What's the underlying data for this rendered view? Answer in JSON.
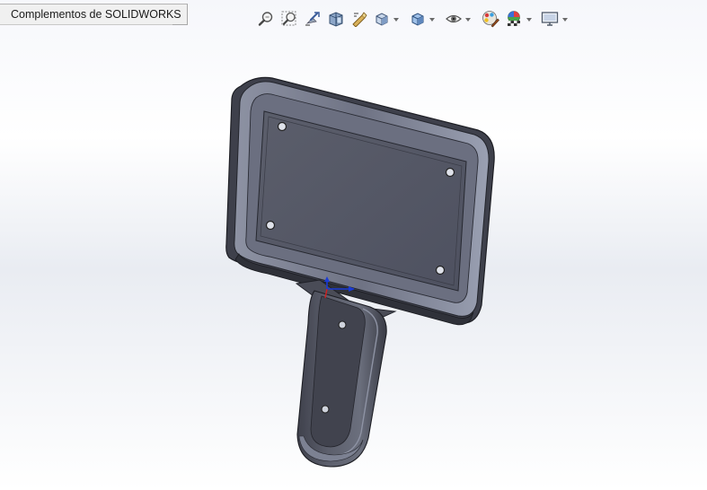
{
  "window": {
    "addin_tab_label": "Complementos de SOLIDWORKS"
  },
  "heads_up_toolbar": {
    "items": [
      {
        "icon": "zoom-to-fit-icon",
        "has_dropdown": false
      },
      {
        "icon": "zoom-to-area-icon",
        "has_dropdown": false
      },
      {
        "icon": "previous-view-icon",
        "has_dropdown": false
      },
      {
        "icon": "section-view-icon",
        "has_dropdown": false
      },
      {
        "icon": "dynamic-annotation-views-icon",
        "has_dropdown": false
      },
      {
        "icon": "view-orientation-icon",
        "has_dropdown": true
      },
      {
        "icon": "display-style-icon",
        "has_dropdown": true
      },
      {
        "icon": "hide-show-items-icon",
        "has_dropdown": true
      },
      {
        "icon": "edit-appearance-icon",
        "has_dropdown": false
      },
      {
        "icon": "apply-scene-icon",
        "has_dropdown": true
      },
      {
        "icon": "view-settings-icon",
        "has_dropdown": true
      }
    ]
  },
  "graphics_area": {
    "model": "handheld-device-housing",
    "triad_colors": {
      "x": "#d42020",
      "y": "#1a3bd6"
    },
    "model_color": "#5b5e6a",
    "background_top": "#f6f7fb",
    "background_mid": "#e9ecf2"
  }
}
